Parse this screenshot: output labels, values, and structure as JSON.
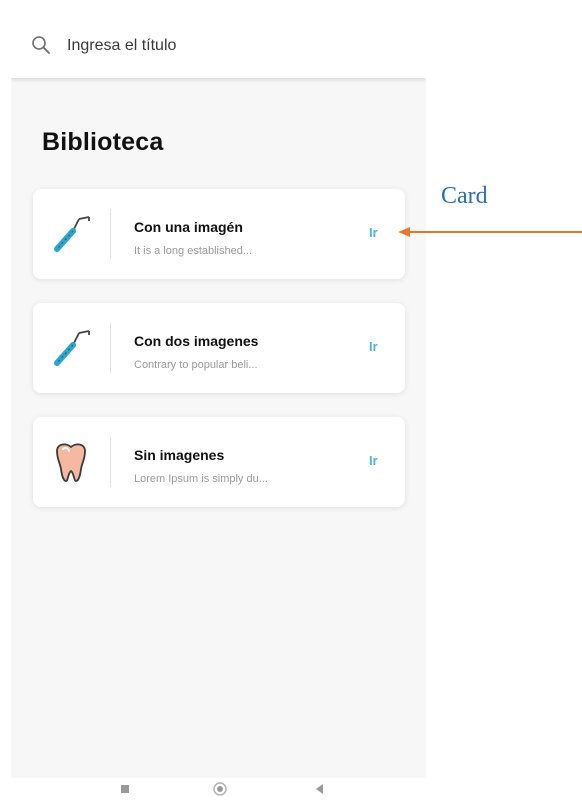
{
  "search": {
    "placeholder": "Ingresa el título"
  },
  "page": {
    "title": "Biblioteca"
  },
  "cards": [
    {
      "title": "Con una imagén",
      "subtitle": "It is a long established...",
      "action": "Ir",
      "icon": "dental-tool-icon"
    },
    {
      "title": "Con dos imagenes",
      "subtitle": "Contrary to popular beli...",
      "action": "Ir",
      "icon": "dental-tool-icon"
    },
    {
      "title": "Sin imagenes",
      "subtitle": "Lorem Ipsum is simply du...",
      "action": "Ir",
      "icon": "tooth-icon"
    }
  ],
  "annotation": {
    "label": "Card"
  },
  "colors": {
    "accent": "#4fb6d8",
    "annotation_text": "#2e6fb0",
    "annotation_arrow": "#e07b2c",
    "ribbon": "#c24a4a"
  },
  "navbar": {
    "buttons": [
      "square-icon",
      "circle-icon",
      "back-triangle-icon"
    ]
  }
}
